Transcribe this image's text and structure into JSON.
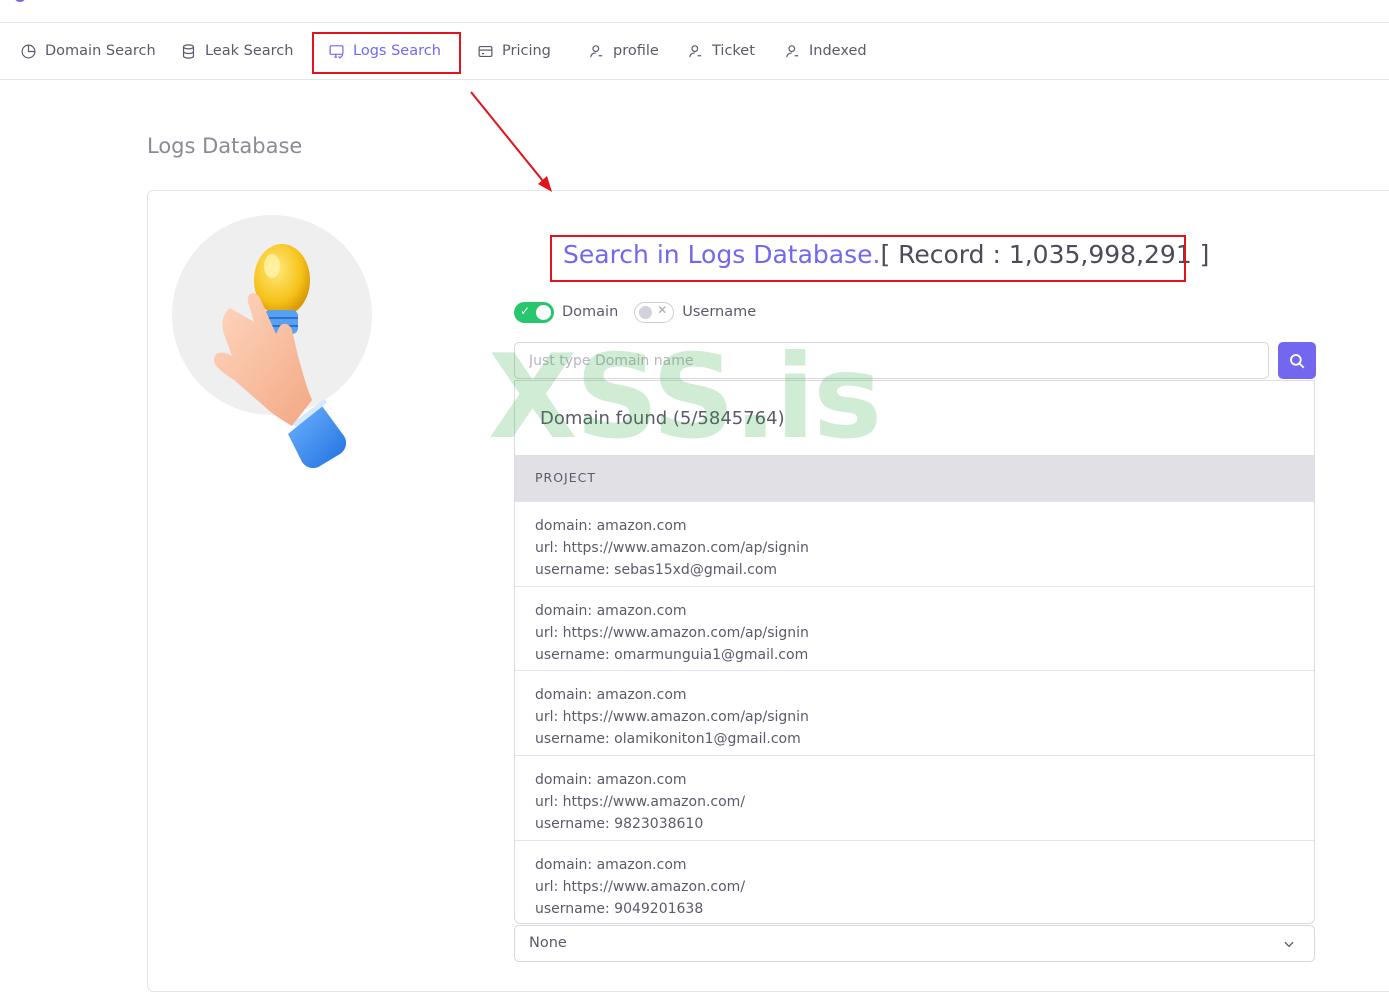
{
  "nav": {
    "items": [
      {
        "label": "Domain Search",
        "icon": "clock-pie-icon"
      },
      {
        "label": "Leak Search",
        "icon": "database-icon"
      },
      {
        "label": "Logs Search",
        "icon": "monitor-check-icon",
        "active": true
      },
      {
        "label": "Pricing",
        "icon": "credit-card-icon"
      },
      {
        "label": "profile",
        "icon": "user-icon"
      },
      {
        "label": "Ticket",
        "icon": "user-icon"
      },
      {
        "label": "Indexed",
        "icon": "user-icon"
      }
    ]
  },
  "page": {
    "title": "Logs Database"
  },
  "search": {
    "heading_link": "Search in Logs Database.",
    "heading_record": "[ Record : 1,035,998,291 ]",
    "toggle_domain": "Domain",
    "toggle_username": "Username",
    "domain_on": true,
    "username_on": false,
    "placeholder": "Just type Domain name"
  },
  "results": {
    "found": "Domain found (5/5845764)",
    "column_header": "PROJECT",
    "rows": [
      {
        "domain": "domain: amazon.com",
        "url": "url: https://www.amazon.com/ap/signin",
        "username": "username: sebas15xd@gmail.com"
      },
      {
        "domain": "domain: amazon.com",
        "url": "url: https://www.amazon.com/ap/signin",
        "username": "username: omarmunguia1@gmail.com"
      },
      {
        "domain": "domain: amazon.com",
        "url": "url: https://www.amazon.com/ap/signin",
        "username": "username: olamikoniton1@gmail.com"
      },
      {
        "domain": "domain: amazon.com",
        "url": "url: https://www.amazon.com/",
        "username": "username: 9823038610"
      },
      {
        "domain": "domain: amazon.com",
        "url": "url: https://www.amazon.com/",
        "username": "username: 9049201638"
      }
    ]
  },
  "select": {
    "value": "None"
  },
  "watermark": "XSS.is",
  "colors": {
    "accent": "#7367f0",
    "success": "#28c76f",
    "annotation_red": "#e1141b"
  }
}
